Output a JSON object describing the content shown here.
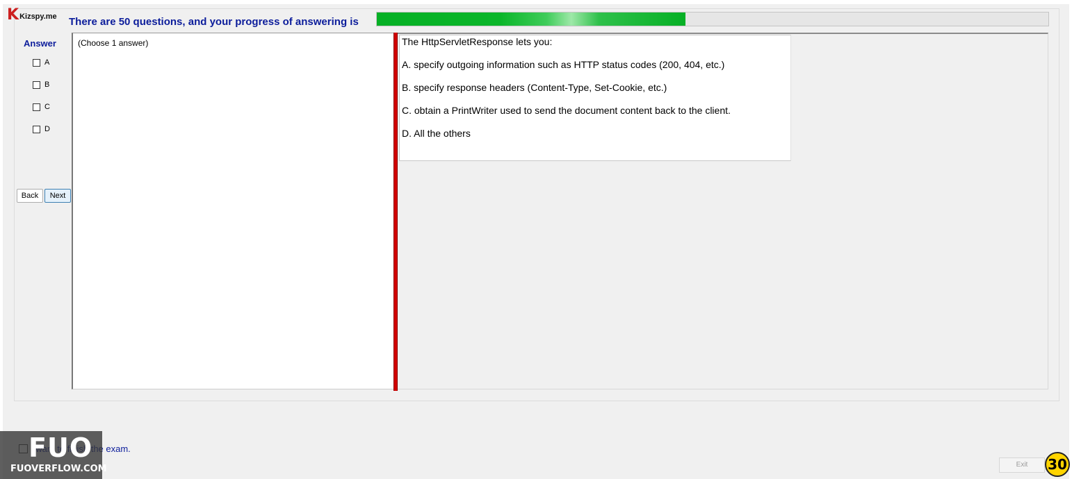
{
  "app": {
    "logo_letter": "K",
    "logo_text": "Kizspy.me"
  },
  "header": {
    "progress_text": "There are 50 questions, and your progress of answering is",
    "progress_fraction": 0.46
  },
  "answer_panel": {
    "title": "Answer",
    "options": [
      "A",
      "B",
      "C",
      "D"
    ],
    "back_label": "Back",
    "next_label": "Next"
  },
  "left_panel": {
    "instruction": "(Choose 1 answer)"
  },
  "question": {
    "stem": "The HttpServletResponse lets you:",
    "choices": [
      "A.  specify outgoing information such as HTTP status codes (200, 404, etc.)",
      "B.  specify response headers (Content-Type, Set-Cookie, etc.)",
      "C.  obtain a PrintWriter used to send the document content back to the client.",
      "D.  All the others"
    ]
  },
  "footer": {
    "finish_label": "I want to finish the exam.",
    "exit_label": "Exit",
    "timer": "30"
  },
  "watermark": {
    "big": "FUO",
    "small": "FUOVERFLOW.COM"
  },
  "colors": {
    "accent_blue": "#0c1d9b",
    "progress_green": "#06b025",
    "splitter_red": "#d20000",
    "timer_yellow": "#ffd400"
  }
}
